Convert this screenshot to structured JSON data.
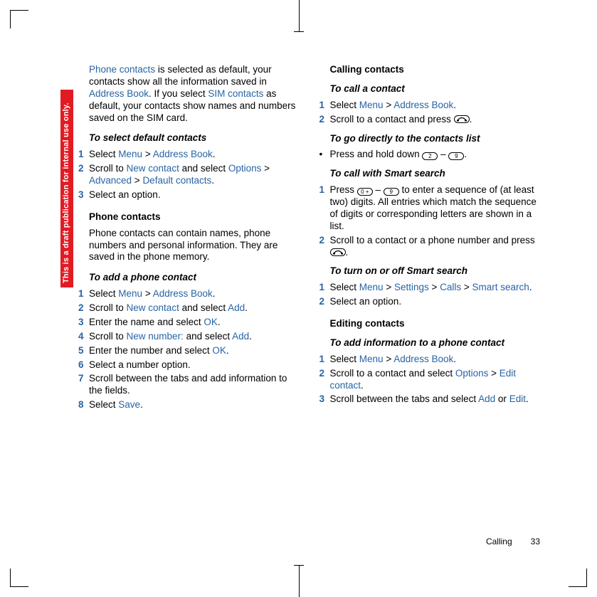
{
  "draft_label": "This is a draft publication for internal use only.",
  "footer": {
    "section": "Calling",
    "page": "33"
  },
  "left": {
    "intro": {
      "pre": "",
      "phone_contacts": "Phone contacts",
      "mid1": " is selected as default, your contacts show all the information saved in ",
      "addr_book": "Address Book",
      "mid2": ". If you select ",
      "sim_contacts": "SIM contacts",
      "mid3": " as default, your contacts show names and numbers saved on the SIM card."
    },
    "h_select_default": "To select default contacts",
    "steps_default": {
      "s1_a": "Select ",
      "s1_menu": "Menu",
      "s1_sep": " > ",
      "s1_ab": "Address Book",
      "s1_end": ".",
      "s2_a": "Scroll to ",
      "s2_nc": "New contact",
      "s2_b": " and select ",
      "s2_opt": "Options",
      "s2_sep": " > ",
      "s2_adv": "Advanced",
      "s2_sep2": " > ",
      "s2_dc": "Default contacts",
      "s2_end": ".",
      "s3": "Select an option."
    },
    "h_phone_contacts": "Phone contacts",
    "phone_para": "Phone contacts can contain names, phone numbers and personal information. They are saved in the phone memory.",
    "h_add_phone": "To add a phone contact",
    "steps_add": {
      "s1_a": "Select ",
      "s1_menu": "Menu",
      "s1_sep": " > ",
      "s1_ab": "Address Book",
      "s1_end": ".",
      "s2_a": "Scroll to ",
      "s2_nc": "New contact",
      "s2_b": " and select ",
      "s2_add": "Add",
      "s2_end": ".",
      "s3_a": "Enter the name and select ",
      "s3_ok": "OK",
      "s3_end": ".",
      "s4_a": "Scroll to ",
      "s4_nn": "New number:",
      "s4_b": " and select ",
      "s4_add": "Add",
      "s4_end": ".",
      "s5_a": "Enter the number and select ",
      "s5_ok": "OK",
      "s5_end": ".",
      "s6": "Select a number option.",
      "s7": "Scroll between the tabs and add information to the fields.",
      "s8_a": "Select ",
      "s8_save": "Save",
      "s8_end": "."
    }
  },
  "right": {
    "h_calling": "Calling contacts",
    "h_call_contact": "To call a contact",
    "call_contact": {
      "s1_a": "Select ",
      "s1_menu": "Menu",
      "s1_sep": " > ",
      "s1_ab": "Address Book",
      "s1_end": ".",
      "s2_a": "Scroll to a contact and press ",
      "s2_end": "."
    },
    "h_directly": "To go directly to the contacts list",
    "direct": {
      "a": "Press and hold down ",
      "dash": " – ",
      "end": "."
    },
    "h_smart": "To call with Smart search",
    "smart": {
      "s1_a": "Press ",
      "s1_dash": " – ",
      "s1_b": " to enter a sequence of (at least two) digits. All entries which match the sequence of digits or corresponding letters are shown in a list.",
      "s2_a": "Scroll to a contact or a phone number and press ",
      "s2_end": "."
    },
    "h_smart_on": "To turn on or off Smart search",
    "smart_on": {
      "s1_a": "Select ",
      "s1_menu": "Menu",
      "s1_sep": " > ",
      "s1_set": "Settings",
      "s1_sep2": " > ",
      "s1_calls": "Calls",
      "s1_sep3": " > ",
      "s1_ss": "Smart search",
      "s1_end": ".",
      "s2": "Select an option."
    },
    "h_edit": "Editing contacts",
    "h_add_info": "To add information to a phone contact",
    "add_info": {
      "s1_a": "Select ",
      "s1_menu": "Menu",
      "s1_sep": " > ",
      "s1_ab": "Address Book",
      "s1_end": ".",
      "s2_a": "Scroll to a contact and select ",
      "s2_opt": "Options",
      "s2_sep": " > ",
      "s2_ec": "Edit contact",
      "s2_end": ".",
      "s3_a": "Scroll between the tabs and select ",
      "s3_add": "Add",
      "s3_or": " or ",
      "s3_edit": "Edit",
      "s3_end": "."
    }
  },
  "keys": {
    "k2": "2",
    "k9": "9",
    "k0": "0 +"
  }
}
